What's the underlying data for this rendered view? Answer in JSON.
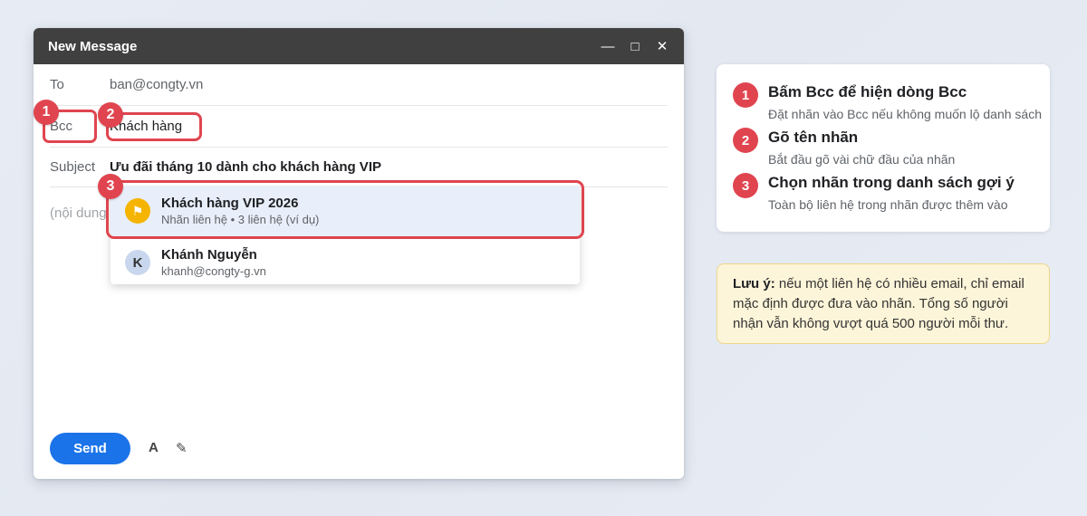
{
  "compose": {
    "title": "New Message",
    "controls": {
      "minimize": "—",
      "maximize": "□",
      "close": "✕"
    },
    "to_label": "To",
    "to_value": "ban@congty.vn",
    "bcc_label": "Bcc",
    "bcc_value": "Khách hàng",
    "subject_label": "Subject",
    "subject_value": "Ưu đãi tháng 10 dành cho khách hàng VIP",
    "body_placeholder": "(nội dung",
    "send_label": "Send",
    "format_icon": "A",
    "pen_icon": "✎"
  },
  "dropdown": {
    "items": [
      {
        "avatar": "⚑",
        "icon": "flag-icon",
        "name": "Khách hàng VIP 2026",
        "sub": "Nhãn liên hệ • 3 liên hệ (ví dụ)",
        "selected": true
      },
      {
        "avatar": "K",
        "icon": "avatar",
        "name": "Khánh Nguyễn",
        "sub": "khanh@congty-g.vn",
        "selected": false
      }
    ]
  },
  "badges": [
    "1",
    "2",
    "3"
  ],
  "steps": [
    {
      "num": "1",
      "title": "Bấm Bcc để hiện dòng Bcc",
      "desc": "Đặt nhãn vào Bcc nếu không muốn lộ danh sách"
    },
    {
      "num": "2",
      "title": "Gõ tên nhãn",
      "desc": "Bắt đầu gõ vài chữ đầu của nhãn"
    },
    {
      "num": "3",
      "title": "Chọn nhãn trong danh sách gợi ý",
      "desc": "Toàn bộ liên hệ trong nhãn được thêm vào"
    }
  ],
  "note": {
    "label": "Lưu ý:",
    "text": " nếu một liên hệ có nhiều email, chỉ email mặc định được đưa vào nhãn. Tổng số người nhận vẫn không vượt quá 500 người mỗi thư."
  },
  "colors": {
    "accent": "#e0454f",
    "send": "#1a73e8",
    "titlebar": "#404040",
    "note_bg": "#fdf5d9"
  }
}
